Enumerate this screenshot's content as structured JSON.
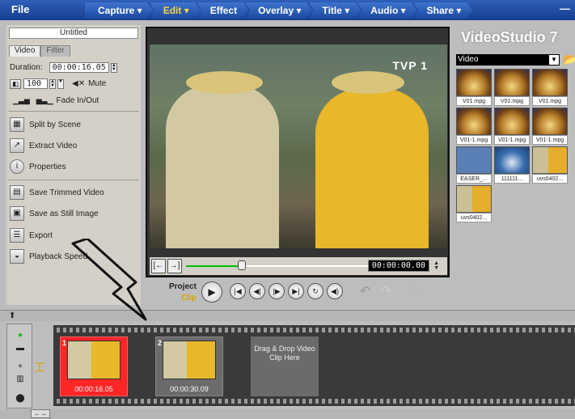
{
  "menubar": {
    "file": "File",
    "steps": [
      {
        "label": "Capture ▾"
      },
      {
        "label": "Edit ▾"
      },
      {
        "label": "Effect"
      },
      {
        "label": "Overlay ▾"
      },
      {
        "label": "Title ▾"
      },
      {
        "label": "Audio ▾"
      },
      {
        "label": "Share ▾"
      }
    ],
    "minimize": "—",
    "active_step": "Edit"
  },
  "options": {
    "title": "Untitled",
    "tabs": [
      "Video",
      "Filter"
    ],
    "duration_label": "Duration:",
    "duration_value": "00:00:16.05",
    "volume_value": "100",
    "mute_label": "Mute",
    "fade_label": "Fade In/Out",
    "items": [
      {
        "label": "Split by Scene",
        "icon": "split-icon"
      },
      {
        "label": "Extract Video",
        "icon": "extract-icon"
      },
      {
        "label": "Properties",
        "icon": "properties-icon"
      },
      {
        "label": "Save Trimmed Video",
        "icon": "trim-icon"
      },
      {
        "label": "Save as Still Image",
        "icon": "still-image-icon"
      },
      {
        "label": "Export",
        "icon": "export-icon"
      },
      {
        "label": "Playback Speed",
        "icon": "speed-icon"
      }
    ]
  },
  "preview": {
    "channel_logo": "TVP 1",
    "timecode": "00:00:00.00",
    "scrub_position": 0.3
  },
  "playback": {
    "project_label": "Project",
    "clip_label": "Clip"
  },
  "library": {
    "brand": "VideoStudio 7",
    "category": "Video",
    "thumbs": [
      {
        "label": "V01.mpg",
        "kind": "coffee"
      },
      {
        "label": "V01.mpg",
        "kind": "coffee"
      },
      {
        "label": "V01.mpg",
        "kind": "coffee"
      },
      {
        "label": "V01-1.mpg",
        "kind": "coffee"
      },
      {
        "label": "V01-1.mpg",
        "kind": "coffee"
      },
      {
        "label": "V01-1.mpg",
        "kind": "coffee"
      },
      {
        "label": "EASER_...",
        "kind": "easer"
      },
      {
        "label": "111111...",
        "kind": "car"
      },
      {
        "label": "uvs0402...",
        "kind": "farm"
      },
      {
        "label": "uvs0402...",
        "kind": "farm"
      }
    ]
  },
  "timeline": {
    "clips": [
      {
        "num": "1",
        "duration": "00:00:16.05",
        "selected": true
      },
      {
        "num": "2",
        "duration": "00:00:30.09",
        "selected": false
      }
    ],
    "dropzone": "Drag & Drop Video Clip Here"
  }
}
